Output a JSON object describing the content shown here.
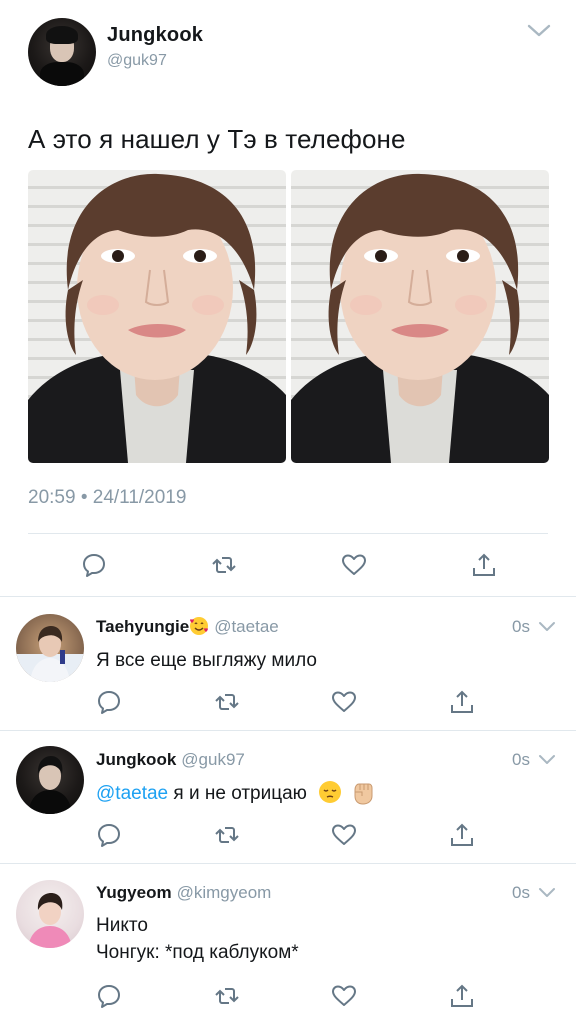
{
  "main_tweet": {
    "author_name": "Jungkook",
    "author_handle": "@guk97",
    "text": "А это я нашел у Тэ в телефоне",
    "timestamp": "20:59 • 24/11/2019"
  },
  "replies": [
    {
      "author_name": "Taehyungie",
      "author_handle": "@taetae",
      "time": "0s",
      "text": "Я все еще выгляжу мило"
    },
    {
      "author_name": "Jungkook",
      "author_handle": "@guk97",
      "time": "0s",
      "mention": "@taetae",
      "text": " я и не отрицаю"
    },
    {
      "author_name": "Yugyeom",
      "author_handle": "@kimgyeom",
      "time": "0s",
      "text_line1": "Никто",
      "text_line2": "Чонгук: *под каблуком*"
    }
  ],
  "icons": {
    "reply": "reply-icon",
    "retweet": "retweet-icon",
    "like": "heart-icon",
    "share": "share-icon",
    "caret": "chevron-down-icon"
  },
  "colors": {
    "text": "#14171a",
    "secondary": "#8899a6",
    "mention": "#1da1f2",
    "icon": "#657786",
    "divider": "#e1e8ed"
  }
}
